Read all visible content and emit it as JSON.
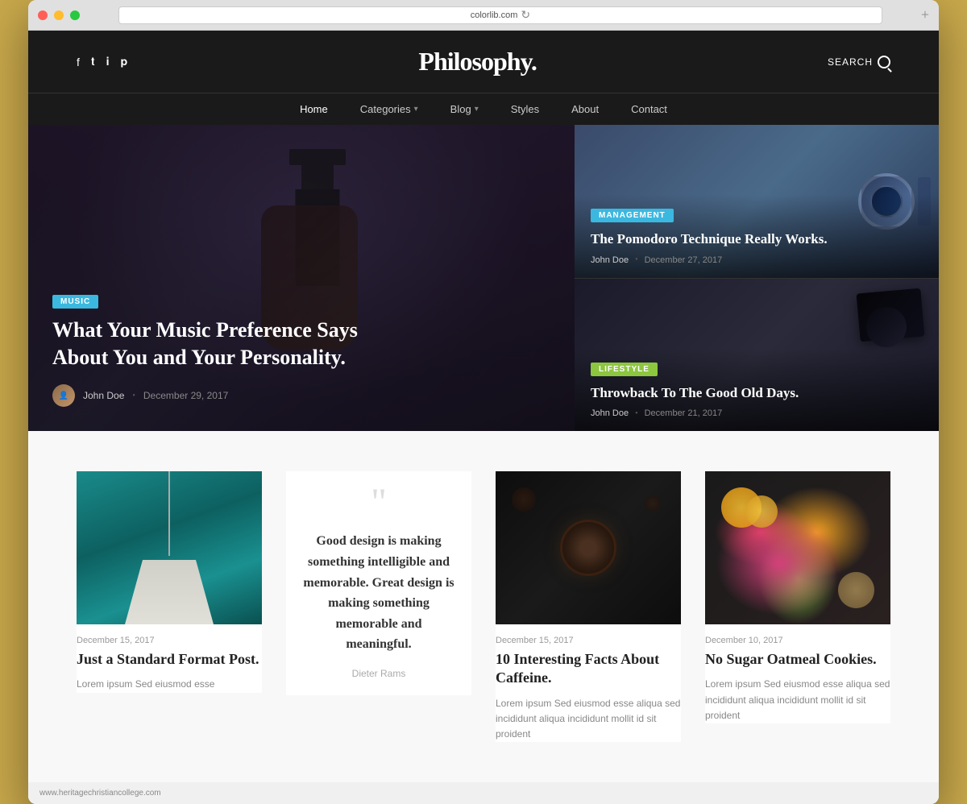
{
  "browser": {
    "url": "colorlib.com",
    "plus_icon": "+",
    "refresh_icon": "↻"
  },
  "header": {
    "logo": "Philosophy.",
    "search_label": "SEARCH",
    "social_icons": [
      "f",
      "𝕥",
      "𝐢",
      "𝐩"
    ]
  },
  "nav": {
    "items": [
      {
        "label": "Home",
        "active": true,
        "has_dropdown": false
      },
      {
        "label": "Categories",
        "active": false,
        "has_dropdown": true
      },
      {
        "label": "Blog",
        "active": false,
        "has_dropdown": true
      },
      {
        "label": "Styles",
        "active": false,
        "has_dropdown": false
      },
      {
        "label": "About",
        "active": false,
        "has_dropdown": false
      },
      {
        "label": "Contact",
        "active": false,
        "has_dropdown": false
      }
    ]
  },
  "hero": {
    "main": {
      "badge": "MUSIC",
      "title": "What Your Music Preference Says About You and Your Personality.",
      "author": "John Doe",
      "date": "December 29, 2017"
    },
    "card1": {
      "badge": "MANAGEMENT",
      "title": "The Pomodoro Technique Really Works.",
      "author": "John Doe",
      "date": "December 27, 2017"
    },
    "card2": {
      "badge": "LIFESTYLE",
      "title": "Throwback To The Good Old Days.",
      "author": "John Doe",
      "date": "December 21, 2017"
    }
  },
  "posts": [
    {
      "date": "December 15, 2017",
      "title": "Just a Standard Format Post.",
      "excerpt": "Lorem ipsum Sed eiusmod esse",
      "image_type": "lamp"
    },
    {
      "type": "quote",
      "quote_text": "Good design is making something intelligible and memorable. Great design is making something memorable and meaningful.",
      "quote_author": "Dieter Rams"
    },
    {
      "date": "December 15, 2017",
      "title": "10 Interesting Facts About Caffeine.",
      "excerpt": "Lorem ipsum Sed eiusmod esse aliqua sed incididunt aliqua incididunt mollit id sit proident",
      "image_type": "coffee"
    },
    {
      "date": "December 10, 2017",
      "title": "No Sugar Oatmeal Cookies.",
      "excerpt": "Lorem ipsum Sed eiusmod esse aliqua sed incididunt aliqua incididunt mollit id sit proident",
      "image_type": "flowers"
    }
  ],
  "footer": {
    "url": "www.heritagechristiancollege.com"
  }
}
